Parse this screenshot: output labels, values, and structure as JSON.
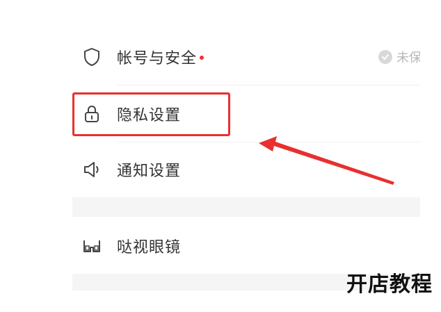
{
  "settings": {
    "items": [
      {
        "label": "帐号与安全",
        "icon": "shield-icon",
        "has_dot": true,
        "status": "未保"
      },
      {
        "label": "隐私设置",
        "icon": "lock-icon"
      },
      {
        "label": "通知设置",
        "icon": "speaker-icon"
      },
      {
        "label": "哒视眼镜",
        "icon": "glasses-icon"
      }
    ]
  },
  "annotation": {
    "highlight_color": "#e8302e",
    "arrow_color": "#e8302e"
  },
  "watermark": {
    "text": "开店教程"
  },
  "colors": {
    "text": "#333333",
    "muted": "#b8b8b8",
    "dot": "#f0303c",
    "band": "#f5f5f5"
  }
}
